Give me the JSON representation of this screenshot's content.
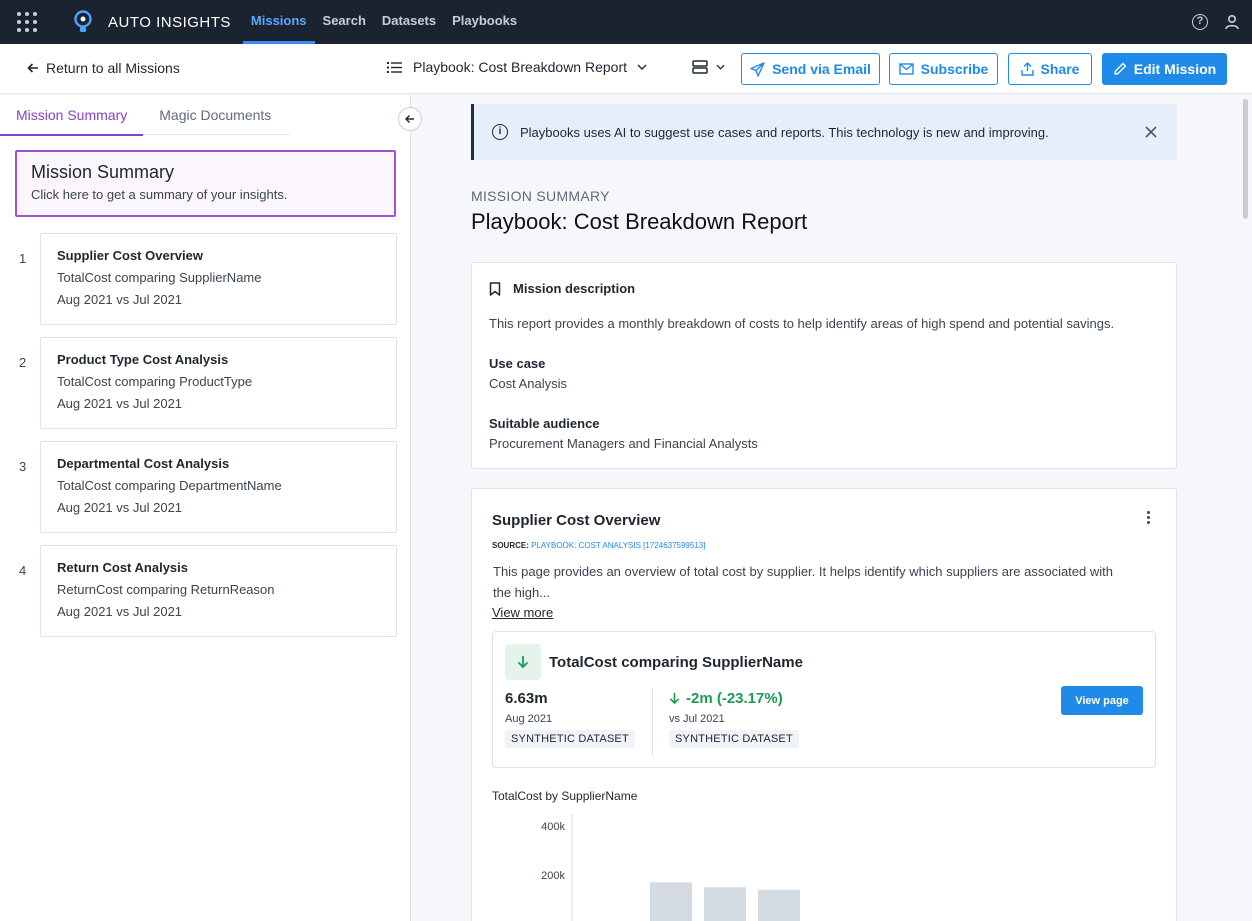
{
  "topbar": {
    "brand": "AUTO INSIGHTS",
    "nav": [
      {
        "label": "Missions",
        "active": true
      },
      {
        "label": "Search",
        "active": false
      },
      {
        "label": "Datasets",
        "active": false
      },
      {
        "label": "Playbooks",
        "active": false
      }
    ]
  },
  "toolbar": {
    "back_label": "Return to all Missions",
    "playbook_label": "Playbook: Cost Breakdown Report",
    "send_email": "Send via Email",
    "subscribe": "Subscribe",
    "share": "Share",
    "edit_mission": "Edit Mission"
  },
  "left": {
    "tabs": [
      {
        "label": "Mission Summary",
        "active": true
      },
      {
        "label": "Magic Documents",
        "active": false
      }
    ],
    "summary_card": {
      "title": "Mission Summary",
      "subtitle": "Click here to get a summary of your insights."
    },
    "items": [
      {
        "num": "1",
        "title": "Supplier Cost Overview",
        "line1": "TotalCost comparing SupplierName",
        "line2": "Aug 2021 vs Jul 2021"
      },
      {
        "num": "2",
        "title": "Product Type Cost Analysis",
        "line1": "TotalCost comparing ProductType",
        "line2": "Aug 2021 vs Jul 2021"
      },
      {
        "num": "3",
        "title": "Departmental Cost Analysis",
        "line1": "TotalCost comparing DepartmentName",
        "line2": "Aug 2021 vs Jul 2021"
      },
      {
        "num": "4",
        "title": "Return Cost Analysis",
        "line1": "ReturnCost comparing ReturnReason",
        "line2": "Aug 2021 vs Jul 2021"
      }
    ]
  },
  "main": {
    "banner": "Playbooks uses AI to suggest use cases and reports. This technology is new and improving.",
    "eyebrow": "MISSION SUMMARY",
    "title": "Playbook: Cost Breakdown Report",
    "description": {
      "header": "Mission description",
      "text": "This report provides a monthly breakdown of costs to help identify areas of high spend and potential savings.",
      "use_case_label": "Use case",
      "use_case": "Cost Analysis",
      "audience_label": "Suitable audience",
      "audience": "Procurement Managers and Financial Analysts"
    },
    "page": {
      "title": "Supplier Cost Overview",
      "source_label": "SOURCE:",
      "source_link": "PLAYBOOK: COST ANALYSIS [1724637599513]",
      "desc_line1": "This page provides an overview of total cost by supplier. It helps identify which suppliers are associated with",
      "desc_line2": "the high...",
      "view_more": "View more",
      "insight": {
        "title": "TotalCost comparing SupplierName",
        "value": "6.63m",
        "period": "Aug 2021",
        "dataset": "SYNTHETIC DATASET",
        "delta": "-2m (-23.17%)",
        "compare": "vs Jul 2021",
        "dataset2": "SYNTHETIC DATASET",
        "view_page": "View page"
      },
      "chart_title": "TotalCost by SupplierName"
    }
  },
  "chart_data": {
    "type": "bar",
    "title": "TotalCost by SupplierName",
    "yticks": [
      "400k",
      "200k"
    ],
    "ylim": [
      0,
      400000
    ],
    "categories": [],
    "values": [
      170000,
      150000,
      140000
    ],
    "color": "#d3dae2"
  },
  "colors": {
    "accent": "#1f8ae8",
    "purple": "#8a3fc4",
    "positive": "#1e9a54",
    "topbar": "#1b2330"
  }
}
